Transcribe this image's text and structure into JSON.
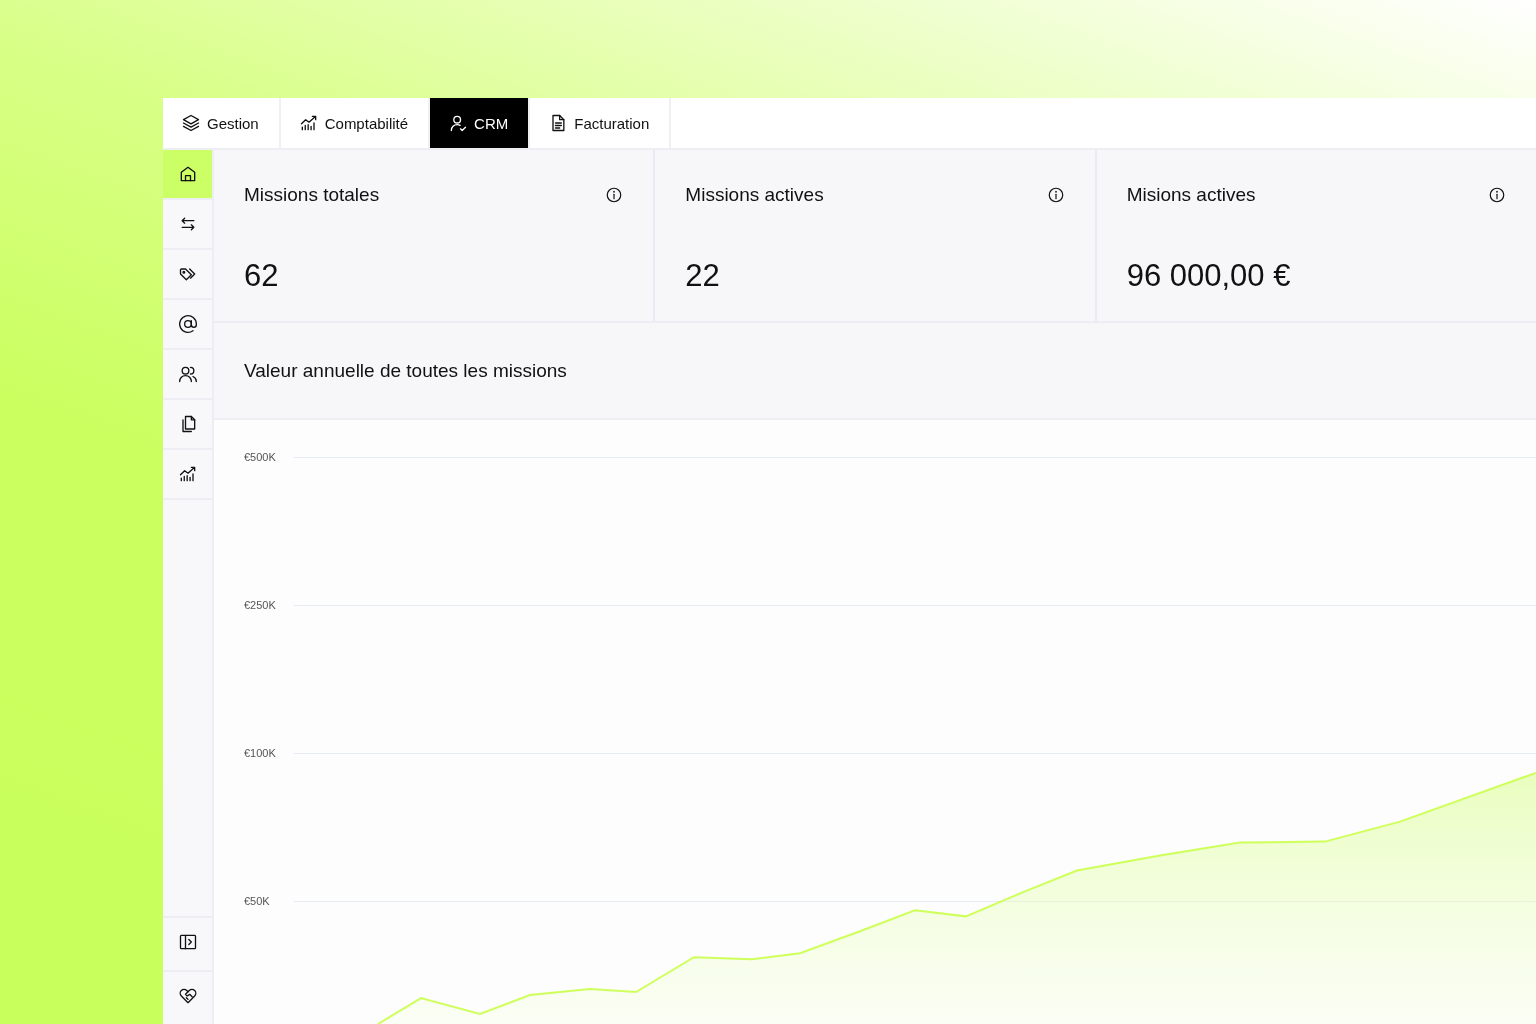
{
  "tabs": [
    {
      "label": "Gestion",
      "selected": false
    },
    {
      "label": "Comptabilité",
      "selected": false
    },
    {
      "label": "CRM",
      "selected": true
    },
    {
      "label": "Facturation",
      "selected": false
    }
  ],
  "sidebar": {
    "items": [
      {
        "selected": true
      },
      {
        "selected": false
      },
      {
        "selected": false
      },
      {
        "selected": false
      },
      {
        "selected": false
      },
      {
        "selected": false
      },
      {
        "selected": false
      }
    ],
    "bottom_items": [
      {
        "selected": false
      },
      {
        "selected": false
      }
    ]
  },
  "stats": [
    {
      "title": "Missions totales",
      "value": "62"
    },
    {
      "title": "Missions actives",
      "value": "22"
    },
    {
      "title": "Misions actives",
      "value": "96 000,00 €"
    }
  ],
  "chart": {
    "title": "Valeur annuelle de toutes les missions",
    "y_ticks": [
      "€500K",
      "€250K",
      "€100K",
      "€50K"
    ]
  }
}
